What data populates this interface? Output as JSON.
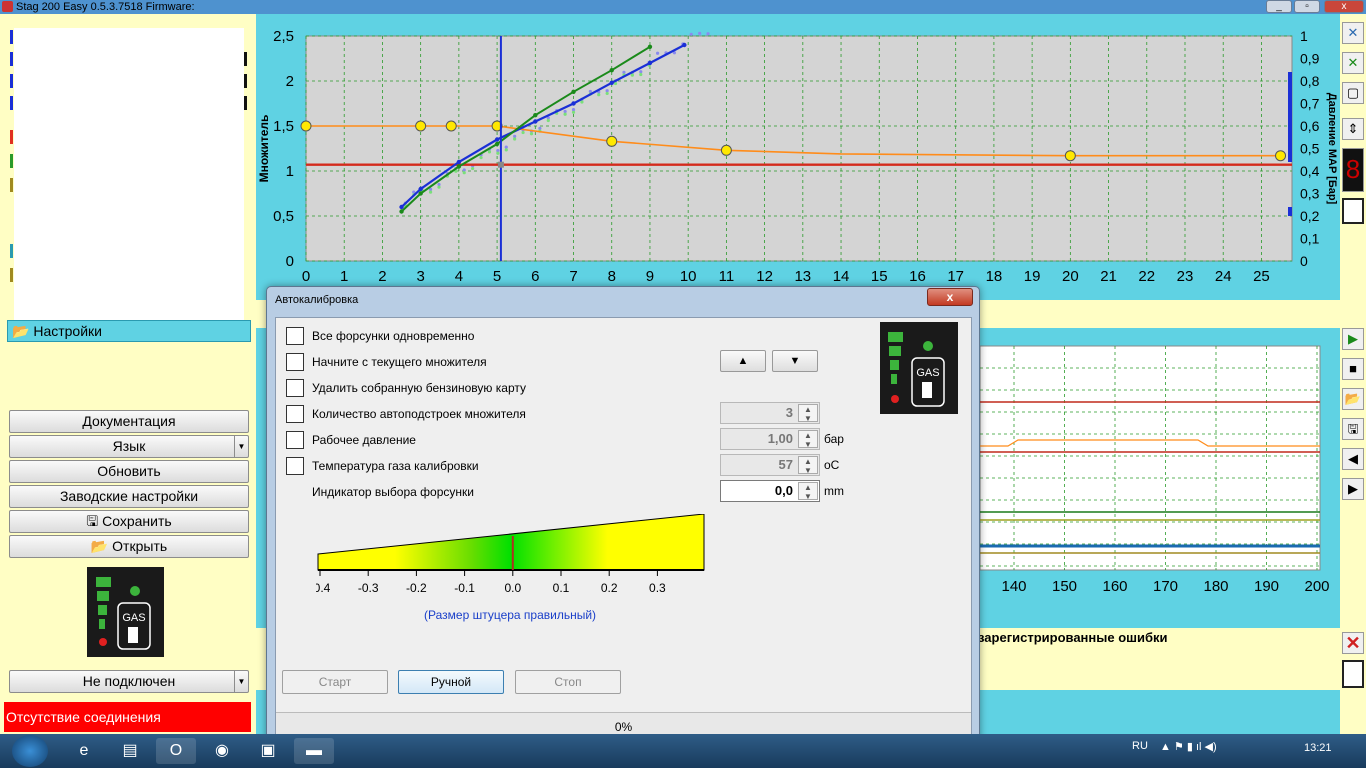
{
  "window": {
    "title": "Stag 200 Easy 0.5.3.7518 Firmware:"
  },
  "left_panel": {
    "settings_tab": "Настройки",
    "buttons": {
      "documentation": "Документация",
      "language": "Язык",
      "refresh": "Обновить",
      "factory": "Заводские настройки",
      "save": "Сохранить",
      "open": "Открыть"
    },
    "connection_select": "Не подключен",
    "error_message": "Отсутствие соединения",
    "logo_text": "GAS"
  },
  "main_chart": {
    "y_left_label": "Множитель",
    "y_right_label": "Давление MAP [Бар]",
    "y_left_ticks": [
      "0",
      "0,5",
      "1",
      "1,5",
      "2",
      "2,5"
    ],
    "y_right_ticks": [
      "0",
      "0,1",
      "0,2",
      "0,3",
      "0,4",
      "0,5",
      "0,6",
      "0,7",
      "0,8",
      "0,9",
      "1"
    ],
    "x_ticks": [
      "0",
      "1",
      "2",
      "3",
      "4",
      "5",
      "6",
      "7",
      "8",
      "9",
      "10",
      "11",
      "12",
      "13",
      "14",
      "15",
      "16",
      "17",
      "18",
      "19",
      "20",
      "21",
      "22",
      "23",
      "24",
      "25"
    ],
    "colors": {
      "orange": "#ff8c1a",
      "red": "#d42a1c",
      "blue": "#1a2fd6",
      "green": "#1a8a1a"
    }
  },
  "chart_data": {
    "type": "line",
    "xlim": [
      0,
      25.8
    ],
    "ylim": [
      0,
      2.5
    ],
    "xlabel": "",
    "ylabel": "Множитель",
    "grid": true,
    "series": [
      {
        "x": [
          0,
          3,
          3.8,
          5,
          8,
          11,
          14,
          20,
          25.5
        ],
        "y": [
          1.5,
          1.5,
          1.5,
          1.5,
          1.33,
          1.23,
          1.19,
          1.17,
          1.17
        ]
      },
      {
        "x": [
          0,
          25.8
        ],
        "y": [
          1.07,
          1.07
        ]
      },
      {
        "x": [
          2.5,
          3,
          4,
          5,
          6,
          7,
          8,
          9,
          9.9
        ],
        "y": [
          0.6,
          0.8,
          1.1,
          1.35,
          1.55,
          1.75,
          1.98,
          2.2,
          2.4
        ]
      },
      {
        "x": [
          2.5,
          3,
          4,
          5,
          6,
          7,
          8,
          9
        ],
        "y": [
          0.55,
          0.75,
          1.05,
          1.3,
          1.62,
          1.88,
          2.12,
          2.38
        ]
      }
    ],
    "vertical_marker_x": 5.1
  },
  "lower_chart": {
    "x_ticks": [
      "140",
      "150",
      "160",
      "170",
      "180",
      "190",
      "200"
    ],
    "errors_title": "зарегистрированные ошибки"
  },
  "dialog": {
    "title": "Автокалибровка",
    "close_label": "x",
    "options": [
      "Все форсунки одновременно",
      "Начните с текущего множителя",
      "Удалить собранную бензиновую карту",
      "Количество автоподстроек множителя",
      "Рабочее давление",
      "Температура газа калибровки"
    ],
    "injector_indicator_label": "Индикатор выбора форсунки",
    "spin_values": {
      "count": "3",
      "pressure": "1,00",
      "temperature": "57",
      "indicator": "0,0"
    },
    "units": {
      "pressure": "бар",
      "temperature": "оС",
      "indicator": "mm"
    },
    "gauge_ticks": [
      "-0.4",
      "-0.3",
      "-0.2",
      "-0.1",
      "0.0",
      "0.1",
      "0.2",
      "0.3"
    ],
    "gauge_value": 0.0,
    "gauge_caption": "(Размер штуцера правильный)",
    "buttons": {
      "start": "Старт",
      "manual": "Ручной",
      "stop": "Стоп"
    },
    "progress": "0%",
    "logo_text": "GAS"
  },
  "taskbar": {
    "lang": "RU",
    "time": "13:21"
  }
}
